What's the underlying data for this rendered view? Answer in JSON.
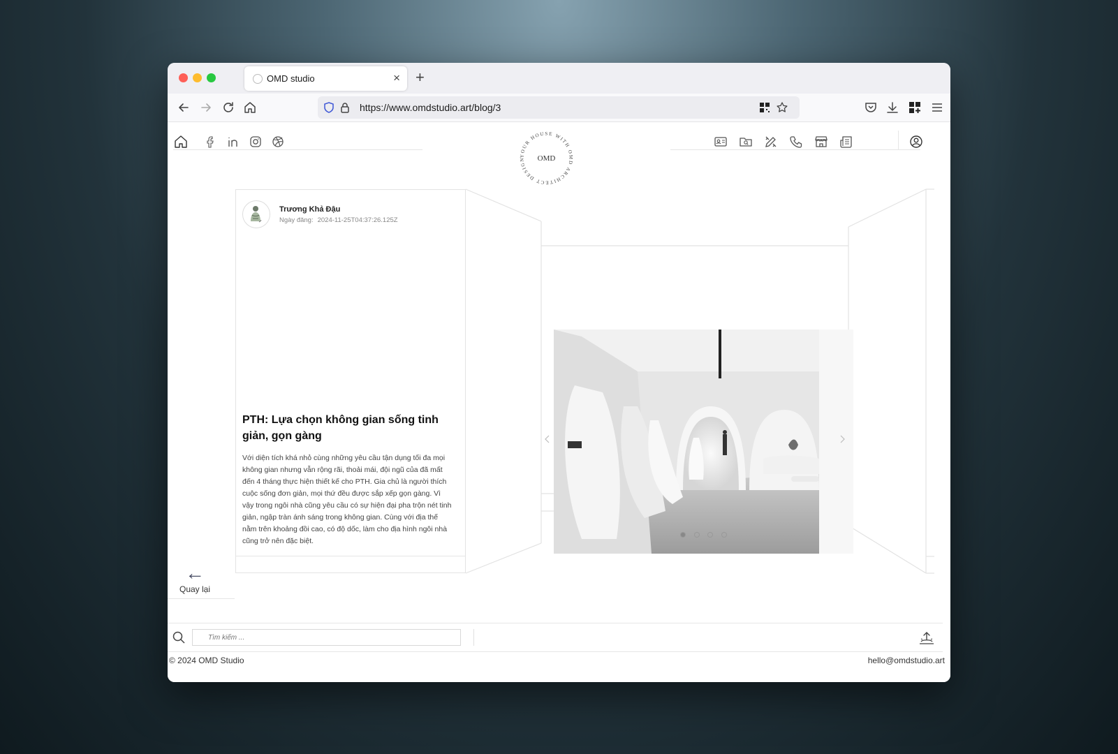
{
  "browser": {
    "tab_title": "OMD studio",
    "tab_close": "×",
    "new_tab": "+",
    "url": "https://www.omdstudio.art/blog/3"
  },
  "site": {
    "logo_text": "OMD",
    "logo_ring_text": "YOUR HOUSE WITH OMD ARCHITECT DESIGN"
  },
  "post": {
    "author": "Trương Khả Đậu",
    "date_label": "Ngày đăng:",
    "date_value": "2024-11-25T04:37:26.125Z",
    "title": "PTH: Lựa chọn không gian sống tinh giản, gọn gàng",
    "body": "Với diện tích khá nhỏ cùng những yêu cầu tận dụng tối đa mọi không gian nhưng vẫn rộng rãi, thoải mái, đội ngũ của đã mất đến 4 tháng thực hiện thiết kế cho PTH. Gia chủ là người thích cuộc sống đơn giản, mọi thứ đều được sắp xếp gọn gàng. Vì vậy trong ngôi nhà cũng yêu cầu có sự hiện đại pha trộn nét tinh giản, ngập tràn ánh sáng trong không gian. Cùng với địa thế nằm trên khoảng đồi cao, có độ dốc, làm cho địa hình ngôi nhà cũng trở nên đặc biệt."
  },
  "back": {
    "arrow": "←",
    "label": "Quay lại"
  },
  "search": {
    "placeholder": "Tìm kiếm ..."
  },
  "footer": {
    "copyright": "© 2024 OMD Studio",
    "email": "hello@omdstudio.art"
  },
  "carousel": {
    "slide_count": 4,
    "active_index": 0
  },
  "colors": {
    "accent_shield": "#3e57d6",
    "icon_gray": "#555555",
    "border_light": "#e3e3e3"
  }
}
